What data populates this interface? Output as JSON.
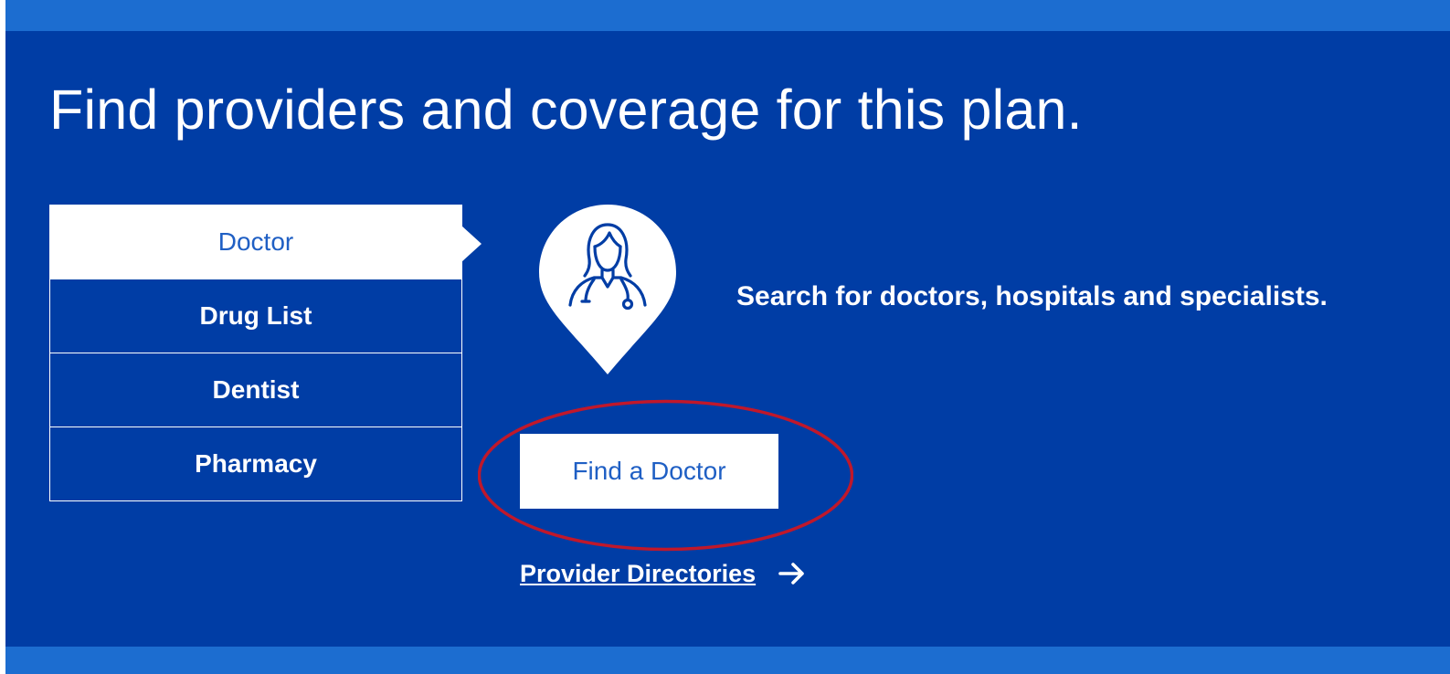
{
  "heading": "Find providers and coverage for this plan.",
  "tabs": [
    {
      "label": "Doctor",
      "active": true
    },
    {
      "label": "Drug List",
      "active": false
    },
    {
      "label": "Dentist",
      "active": false
    },
    {
      "label": "Pharmacy",
      "active": false
    }
  ],
  "content": {
    "icon": "doctor-location-pin-icon",
    "description": "Search for doctors, hospitals and specialists.",
    "button_label": "Find a Doctor",
    "link_label": "Provider Directories",
    "link_icon": "arrow-right-icon"
  },
  "colors": {
    "panel": "#003da5",
    "band": "#1c6dd0",
    "accent_text": "#1f5fc4",
    "highlight_ring": "#c0182b"
  }
}
